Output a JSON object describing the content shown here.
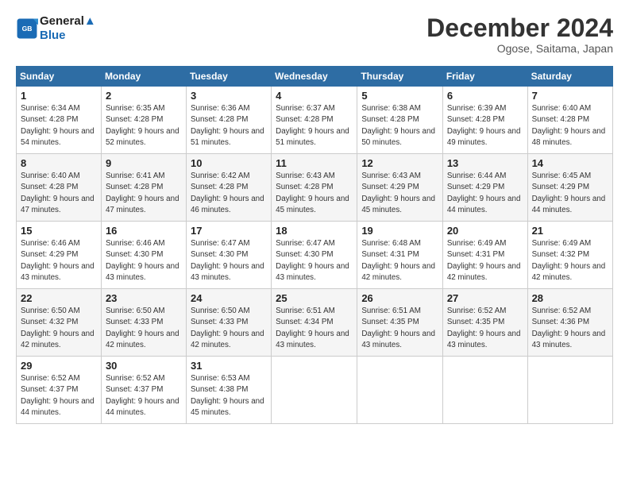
{
  "header": {
    "logo_line1": "General",
    "logo_line2": "Blue",
    "month": "December 2024",
    "location": "Ogose, Saitama, Japan"
  },
  "weekdays": [
    "Sunday",
    "Monday",
    "Tuesday",
    "Wednesday",
    "Thursday",
    "Friday",
    "Saturday"
  ],
  "weeks": [
    [
      {
        "day": "1",
        "sunrise": "6:34 AM",
        "sunset": "4:28 PM",
        "daylight": "9 hours and 54 minutes."
      },
      {
        "day": "2",
        "sunrise": "6:35 AM",
        "sunset": "4:28 PM",
        "daylight": "9 hours and 52 minutes."
      },
      {
        "day": "3",
        "sunrise": "6:36 AM",
        "sunset": "4:28 PM",
        "daylight": "9 hours and 51 minutes."
      },
      {
        "day": "4",
        "sunrise": "6:37 AM",
        "sunset": "4:28 PM",
        "daylight": "9 hours and 51 minutes."
      },
      {
        "day": "5",
        "sunrise": "6:38 AM",
        "sunset": "4:28 PM",
        "daylight": "9 hours and 50 minutes."
      },
      {
        "day": "6",
        "sunrise": "6:39 AM",
        "sunset": "4:28 PM",
        "daylight": "9 hours and 49 minutes."
      },
      {
        "day": "7",
        "sunrise": "6:40 AM",
        "sunset": "4:28 PM",
        "daylight": "9 hours and 48 minutes."
      }
    ],
    [
      {
        "day": "8",
        "sunrise": "6:40 AM",
        "sunset": "4:28 PM",
        "daylight": "9 hours and 47 minutes."
      },
      {
        "day": "9",
        "sunrise": "6:41 AM",
        "sunset": "4:28 PM",
        "daylight": "9 hours and 47 minutes."
      },
      {
        "day": "10",
        "sunrise": "6:42 AM",
        "sunset": "4:28 PM",
        "daylight": "9 hours and 46 minutes."
      },
      {
        "day": "11",
        "sunrise": "6:43 AM",
        "sunset": "4:28 PM",
        "daylight": "9 hours and 45 minutes."
      },
      {
        "day": "12",
        "sunrise": "6:43 AM",
        "sunset": "4:29 PM",
        "daylight": "9 hours and 45 minutes."
      },
      {
        "day": "13",
        "sunrise": "6:44 AM",
        "sunset": "4:29 PM",
        "daylight": "9 hours and 44 minutes."
      },
      {
        "day": "14",
        "sunrise": "6:45 AM",
        "sunset": "4:29 PM",
        "daylight": "9 hours and 44 minutes."
      }
    ],
    [
      {
        "day": "15",
        "sunrise": "6:46 AM",
        "sunset": "4:29 PM",
        "daylight": "9 hours and 43 minutes."
      },
      {
        "day": "16",
        "sunrise": "6:46 AM",
        "sunset": "4:30 PM",
        "daylight": "9 hours and 43 minutes."
      },
      {
        "day": "17",
        "sunrise": "6:47 AM",
        "sunset": "4:30 PM",
        "daylight": "9 hours and 43 minutes."
      },
      {
        "day": "18",
        "sunrise": "6:47 AM",
        "sunset": "4:30 PM",
        "daylight": "9 hours and 43 minutes."
      },
      {
        "day": "19",
        "sunrise": "6:48 AM",
        "sunset": "4:31 PM",
        "daylight": "9 hours and 42 minutes."
      },
      {
        "day": "20",
        "sunrise": "6:49 AM",
        "sunset": "4:31 PM",
        "daylight": "9 hours and 42 minutes."
      },
      {
        "day": "21",
        "sunrise": "6:49 AM",
        "sunset": "4:32 PM",
        "daylight": "9 hours and 42 minutes."
      }
    ],
    [
      {
        "day": "22",
        "sunrise": "6:50 AM",
        "sunset": "4:32 PM",
        "daylight": "9 hours and 42 minutes."
      },
      {
        "day": "23",
        "sunrise": "6:50 AM",
        "sunset": "4:33 PM",
        "daylight": "9 hours and 42 minutes."
      },
      {
        "day": "24",
        "sunrise": "6:50 AM",
        "sunset": "4:33 PM",
        "daylight": "9 hours and 42 minutes."
      },
      {
        "day": "25",
        "sunrise": "6:51 AM",
        "sunset": "4:34 PM",
        "daylight": "9 hours and 43 minutes."
      },
      {
        "day": "26",
        "sunrise": "6:51 AM",
        "sunset": "4:35 PM",
        "daylight": "9 hours and 43 minutes."
      },
      {
        "day": "27",
        "sunrise": "6:52 AM",
        "sunset": "4:35 PM",
        "daylight": "9 hours and 43 minutes."
      },
      {
        "day": "28",
        "sunrise": "6:52 AM",
        "sunset": "4:36 PM",
        "daylight": "9 hours and 43 minutes."
      }
    ],
    [
      {
        "day": "29",
        "sunrise": "6:52 AM",
        "sunset": "4:37 PM",
        "daylight": "9 hours and 44 minutes."
      },
      {
        "day": "30",
        "sunrise": "6:52 AM",
        "sunset": "4:37 PM",
        "daylight": "9 hours and 44 minutes."
      },
      {
        "day": "31",
        "sunrise": "6:53 AM",
        "sunset": "4:38 PM",
        "daylight": "9 hours and 45 minutes."
      },
      null,
      null,
      null,
      null
    ]
  ]
}
